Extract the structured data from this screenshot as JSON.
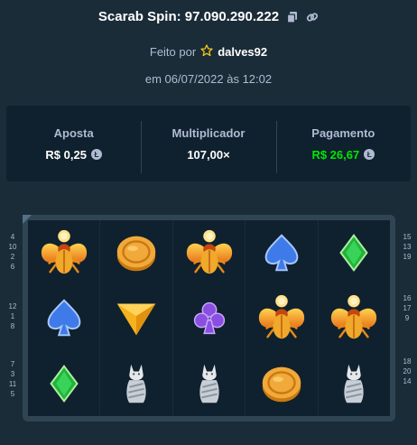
{
  "header": {
    "title": "Scarab Spin: 97.090.290.222",
    "copy_icon": "copy-icon",
    "link_icon": "link-icon"
  },
  "meta": {
    "made_by": "Feito por",
    "user": "dalves92",
    "date": "em 06/07/2022 às 12:02"
  },
  "stats": {
    "bet_label": "Aposta",
    "bet_value": "R$ 0,25",
    "multiplier_label": "Multiplicador",
    "multiplier_value": "107,00×",
    "payout_label": "Pagamento",
    "payout_value": "R$ 26,67",
    "currency_icon": "litecoin-icon",
    "win_color": "#00e701"
  },
  "board": {
    "reels": [
      [
        "scarab",
        "spade",
        "diamond"
      ],
      [
        "coin",
        "triangle",
        "cat"
      ],
      [
        "scarab",
        "club",
        "cat"
      ],
      [
        "spade",
        "scarab",
        "coin"
      ],
      [
        "diamond",
        "scarab",
        "cat"
      ]
    ],
    "paylines_left": [
      [
        "4",
        "10",
        "2",
        "6"
      ],
      [
        "12",
        "1",
        "8"
      ],
      [
        "7",
        "3",
        "11",
        "5"
      ]
    ],
    "paylines_right": [
      [
        "15",
        "13",
        "19"
      ],
      [
        "16",
        "17",
        "9"
      ],
      [
        "18",
        "20",
        "14"
      ]
    ]
  }
}
